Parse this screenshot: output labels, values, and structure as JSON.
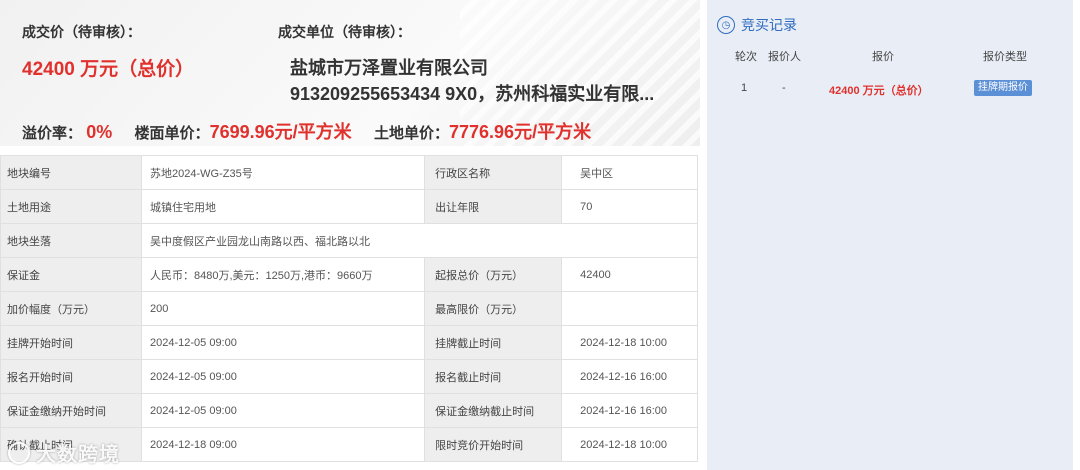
{
  "summary": {
    "price_label": "成交价（待审核）：",
    "price_value": "42400 万元（总价）",
    "winner_label": "成交单位（待审核）：",
    "winner_line1": "盐城市万泽置业有限公司",
    "winner_line2": "913209255653434 9X0，苏州科福实业有限...",
    "premium_label": "溢价率：",
    "premium_value": "0%",
    "floor_price_label": "楼面单价：",
    "floor_price_value": "7699.96元/平方米",
    "land_price_label": "土地单价：",
    "land_price_value": "7776.96元/平方米"
  },
  "info": {
    "plot_no_label": "地块编号",
    "plot_no": "苏地2024-WG-Z35号",
    "district_label": "行政区名称",
    "district": "吴中区",
    "use_label": "土地用途",
    "use": "城镇住宅用地",
    "term_label": "出让年限",
    "term": "70",
    "location_label": "地块坐落",
    "location": "吴中度假区产业园龙山南路以西、福北路以北",
    "deposit_label": "保证金",
    "deposit": "人民币：8480万,美元：1250万,港币：9660万",
    "start_price_label": "起报总价（万元）",
    "start_price": "42400",
    "increment_label": "加价幅度（万元）",
    "increment": "200",
    "max_price_label": "最高限价（万元）",
    "max_price": "",
    "listing_start_label": "挂牌开始时间",
    "listing_start": "2024-12-05 09:00",
    "listing_end_label": "挂牌截止时间",
    "listing_end": "2024-12-18 10:00",
    "signup_start_label": "报名开始时间",
    "signup_start": "2024-12-05 09:00",
    "signup_end_label": "报名截止时间",
    "signup_end": "2024-12-16 16:00",
    "deposit_start_label": "保证金缴纳开始时间",
    "deposit_start": "2024-12-05 09:00",
    "deposit_end_label": "保证金缴纳截止时间",
    "deposit_end": "2024-12-16 16:00",
    "confirm_end_label": "确认截止时间",
    "confirm_end": "2024-12-18 09:00",
    "bid_start_label": "限时竞价开始时间",
    "bid_start": "2024-12-18 10:00"
  },
  "watermark": "大数跨境",
  "bids": {
    "title": "竞买记录",
    "icon": "document-clock-icon",
    "headers": [
      "轮次",
      "报价人",
      "报价",
      "报价类型"
    ],
    "rows": [
      {
        "round": "1",
        "bidder": "-",
        "price": "42400 万元（总价）",
        "type": "挂牌期报价"
      }
    ]
  },
  "colors": {
    "accent_red": "#e0312d",
    "accent_blue": "#2f6cc0",
    "panel_bg": "#e9eef6"
  }
}
